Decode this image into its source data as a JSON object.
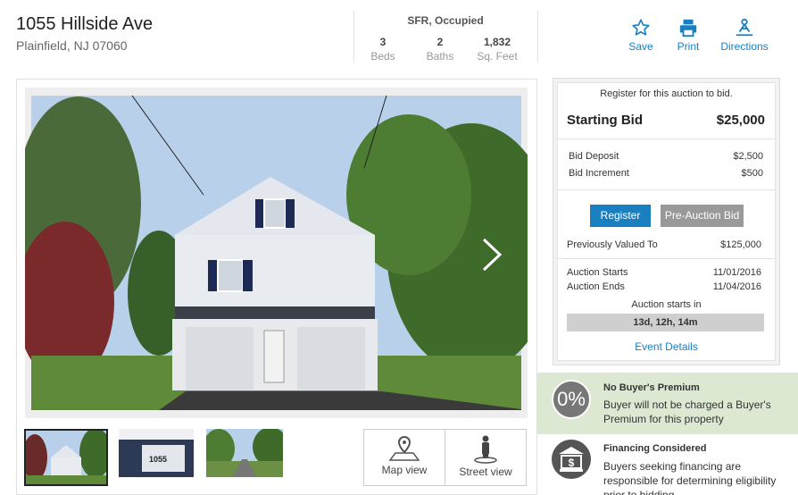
{
  "header": {
    "address_line1": "1055 Hillside Ave",
    "address_line2": "Plainfield, NJ 07060",
    "property_type": "SFR, Occupied",
    "stats": [
      {
        "value": "3",
        "label": "Beds"
      },
      {
        "value": "2",
        "label": "Baths"
      },
      {
        "value": "1,832",
        "label": "Sq. Feet"
      }
    ],
    "actions": [
      {
        "label": "Save",
        "icon": "star-icon"
      },
      {
        "label": "Print",
        "icon": "printer-icon"
      },
      {
        "label": "Directions",
        "icon": "directions-icon"
      }
    ]
  },
  "gallery": {
    "map_view_label": "Map view",
    "street_view_label": "Street view",
    "thumb2_text": "1055"
  },
  "bid": {
    "register_prompt": "Register for this auction to bid.",
    "starting_bid_label": "Starting Bid",
    "starting_bid_value": "$25,000",
    "deposit_label": "Bid Deposit",
    "deposit_value": "$2,500",
    "increment_label": "Bid Increment",
    "increment_value": "$500",
    "register_button": "Register",
    "pre_auction_button": "Pre-Auction Bid",
    "prev_valued_label": "Previously Valued To",
    "prev_valued_value": "$125,000",
    "auction_starts_label": "Auction Starts",
    "auction_starts_value": "11/01/2016",
    "auction_ends_label": "Auction Ends",
    "auction_ends_value": "11/04/2016",
    "starts_in_label": "Auction starts in",
    "countdown": "13d, 12h, 14m",
    "event_details_link": "Event Details"
  },
  "promos": {
    "premium_badge": "0%",
    "premium_title": "No Buyer's Premium",
    "premium_text": "Buyer will not be charged a Buyer's Premium for this property",
    "financing_title": "Financing Considered",
    "financing_text": "Buyers seeking financing are responsible for determining eligibility prior to bidding."
  },
  "colors": {
    "link_blue": "#1a7fc1",
    "register_blue": "#1a7fc1",
    "pre_auction_gray": "#999999",
    "promo_green_bg": "#dde8d3"
  }
}
